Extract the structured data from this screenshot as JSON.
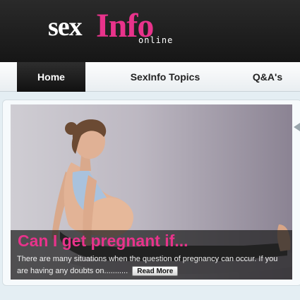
{
  "logo": {
    "part1": "sex",
    "part2": "Info",
    "tagline": "online"
  },
  "nav": {
    "items": [
      "Home",
      "SexInfo Topics",
      "Q&A's"
    ],
    "active": "Home"
  },
  "feature": {
    "title": "Can I get pregnant if...",
    "text": "There are many situations when the question of pregnancy can occur. If you are having any doubts on...........",
    "button": "Read More"
  },
  "colors": {
    "brand_pink": "#e8338b",
    "header_bg": "#1c1c1c",
    "page_bg": "#e4eef3"
  }
}
